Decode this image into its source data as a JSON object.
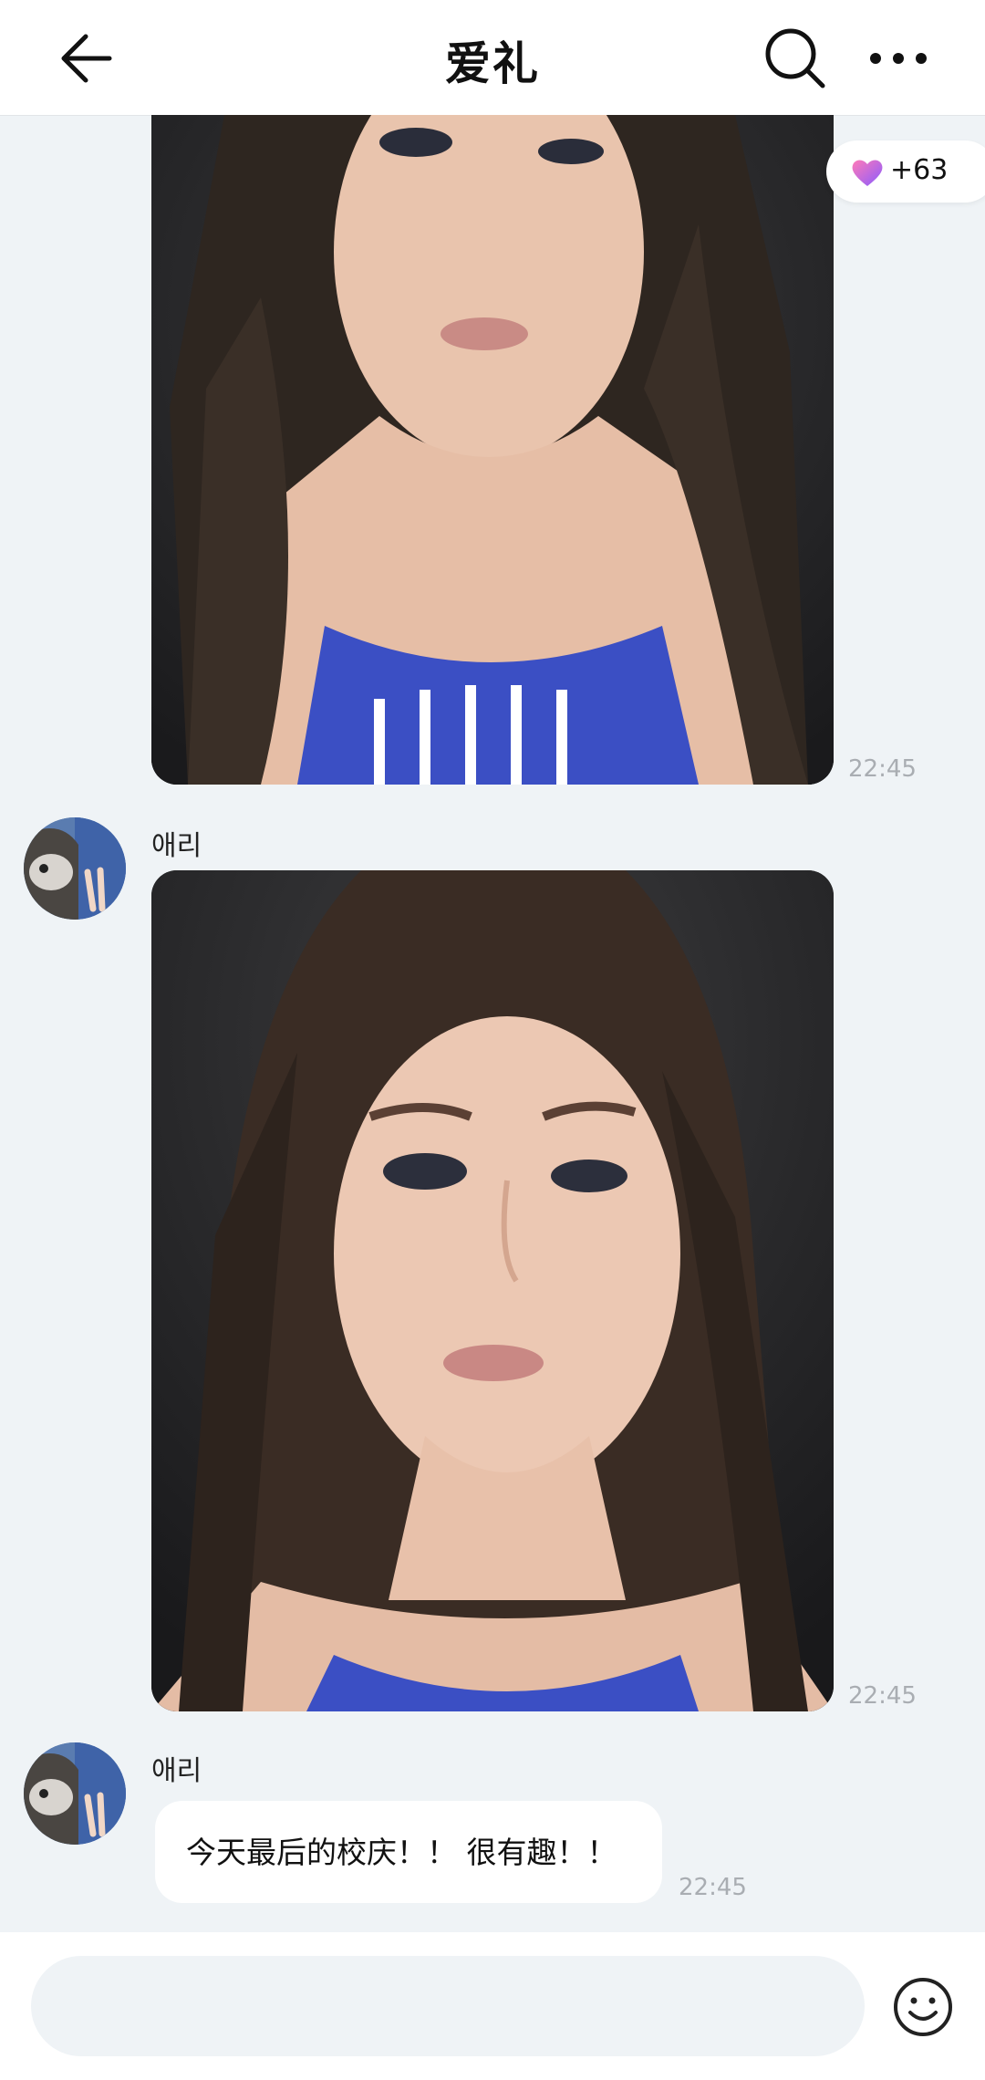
{
  "header": {
    "title": "爱礼",
    "icons": [
      "back-arrow-icon",
      "search-icon",
      "more-icon"
    ]
  },
  "like_badge": {
    "icon": "heart-icon",
    "count": "+63"
  },
  "messages": [
    {
      "type": "image",
      "time": "22:45",
      "content": "selfie photo"
    },
    {
      "type": "image",
      "sender": "애리",
      "time": "22:45",
      "content": "selfie photo"
    },
    {
      "type": "text",
      "sender": "애리",
      "text": "今天最后的校庆！！ 很有趣！！",
      "time": "22:45"
    }
  ],
  "input": {
    "placeholder": "",
    "emoji_icon": "smiley-icon"
  },
  "colors": {
    "background": "#eff3f6",
    "bubble": "#ffffff",
    "timestamp": "#a9adb2"
  }
}
